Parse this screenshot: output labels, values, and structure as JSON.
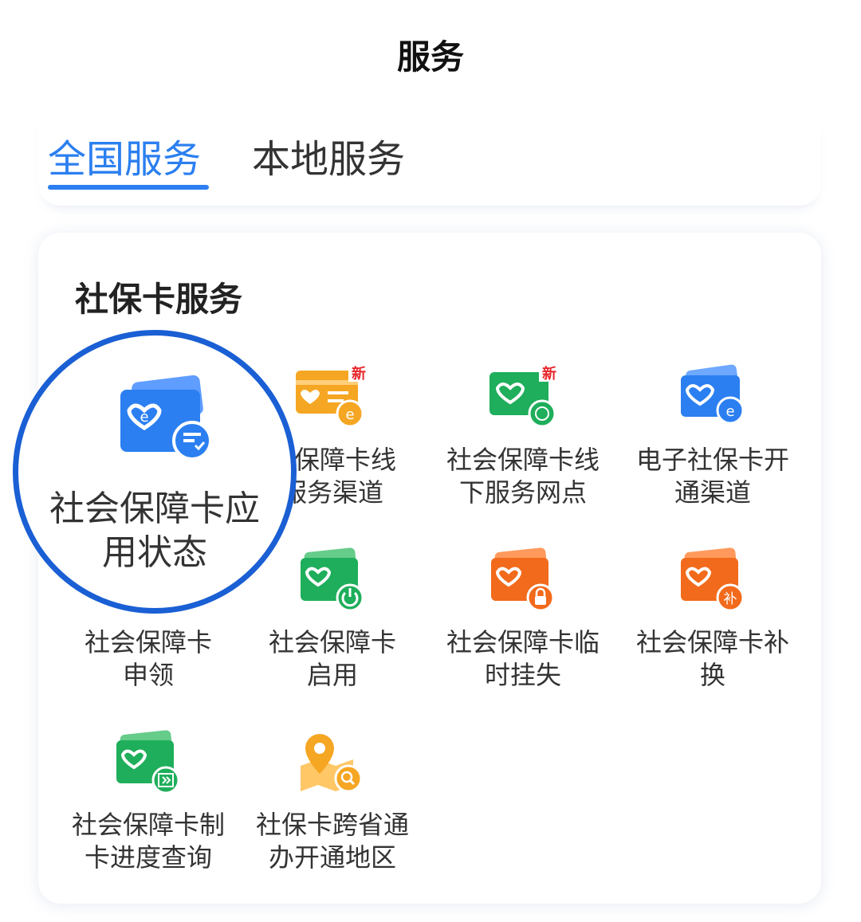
{
  "header": {
    "title": "服务"
  },
  "tabs": [
    {
      "label": "全国服务",
      "active": true
    },
    {
      "label": "本地服务",
      "active": false
    }
  ],
  "section": {
    "title": "社保卡服务"
  },
  "items": [
    {
      "label": "社会保障卡应用状态",
      "icon": "card-status-icon",
      "color": "#2b7ff0"
    },
    {
      "label": "社会保障卡线上服务渠道",
      "icon": "card-online-channel-icon",
      "color": "#f5a623",
      "badge": "新"
    },
    {
      "label": "社会保障卡线下服务网点",
      "icon": "card-offline-outlet-icon",
      "color": "#1fae5b",
      "badge": "新"
    },
    {
      "label": "电子社保卡开通渠道",
      "icon": "e-card-open-icon",
      "color": "#2b7ff0"
    },
    {
      "label": "社会保障卡申领",
      "icon": "card-apply-icon",
      "color": "#2b7ff0"
    },
    {
      "label": "社会保障卡启用",
      "icon": "card-activate-icon",
      "color": "#1fae5b"
    },
    {
      "label": "社会保障卡临时挂失",
      "icon": "card-lost-report-icon",
      "color": "#f26a1b"
    },
    {
      "label": "社会保障卡补换",
      "icon": "card-replace-icon",
      "color": "#f26a1b"
    },
    {
      "label": "社会保障卡制卡进度查询",
      "icon": "card-progress-icon",
      "color": "#1fae5b"
    },
    {
      "label": "社保卡跨省通办开通地区",
      "icon": "map-search-icon",
      "color": "#f5a623"
    }
  ],
  "magnifier": {
    "label_line1": "社会保障卡应",
    "label_line2": "用状态"
  },
  "labels": {
    "online_l1": "会保障卡线",
    "online_l2": "服务渠道",
    "offline_l1": "社会保障卡线",
    "offline_l2": "下服务网点",
    "ecard_l1": "电子社保卡开",
    "ecard_l2": "通渠道",
    "apply_l1": "社会保障卡",
    "apply_l2": "申领",
    "activate_l1": "社会保障卡",
    "activate_l2": "启用",
    "lost_l1": "社会保障卡临",
    "lost_l2": "时挂失",
    "replace_l1": "社会保障卡补",
    "replace_l2": "换",
    "progress_l1": "社会保障卡制",
    "progress_l2": "卡进度查询",
    "crossprov_l1": "社保卡跨省通",
    "crossprov_l2": "办开通地区"
  },
  "badges": {
    "online": "新",
    "offline": "新",
    "replace_sub": "补"
  }
}
